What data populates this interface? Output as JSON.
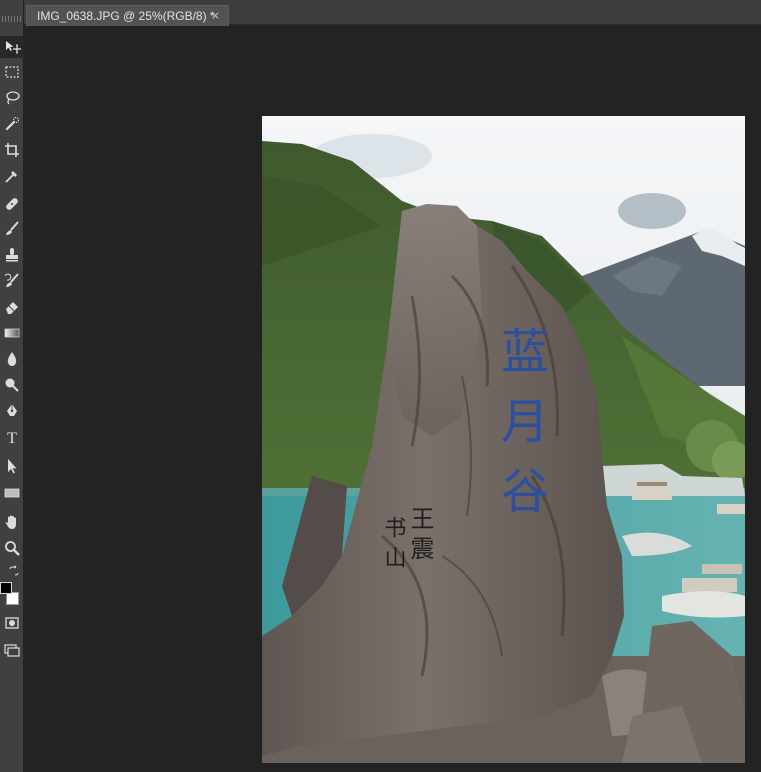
{
  "document_tab": {
    "title": "IMG_0638.JPG @ 25%(RGB/8) *",
    "close_glyph": "×"
  },
  "toolbar": {
    "tools": [
      {
        "name": "move-tool",
        "icon": "move-icon",
        "active": true
      },
      {
        "name": "marquee-tool",
        "icon": "marquee-icon"
      },
      {
        "name": "lasso-tool",
        "icon": "lasso-icon"
      },
      {
        "name": "quick-selection-tool",
        "icon": "quick-selection-icon"
      },
      {
        "name": "crop-tool",
        "icon": "crop-icon"
      },
      {
        "name": "eyedropper-tool",
        "icon": "eyedropper-icon"
      },
      {
        "name": "healing-brush-tool",
        "icon": "bandage-icon"
      },
      {
        "name": "brush-tool",
        "icon": "brush-icon"
      },
      {
        "name": "clone-stamp-tool",
        "icon": "stamp-icon"
      },
      {
        "name": "history-brush-tool",
        "icon": "history-brush-icon"
      },
      {
        "name": "eraser-tool",
        "icon": "eraser-icon"
      },
      {
        "name": "gradient-tool",
        "icon": "gradient-icon"
      },
      {
        "name": "blur-tool",
        "icon": "drop-icon"
      },
      {
        "name": "dodge-tool",
        "icon": "dodge-icon"
      },
      {
        "name": "pen-tool",
        "icon": "pen-icon"
      },
      {
        "name": "type-tool",
        "icon": "type-icon",
        "glyph": "T"
      },
      {
        "name": "path-selection-tool",
        "icon": "arrow-icon"
      },
      {
        "name": "shape-tool",
        "icon": "rectangle-icon"
      },
      {
        "name": "hand-tool",
        "icon": "hand-icon"
      },
      {
        "name": "zoom-tool",
        "icon": "zoom-icon"
      },
      {
        "name": "quick-mask-tool",
        "icon": "quick-mask-icon"
      },
      {
        "name": "screen-mode-tool",
        "icon": "screen-mode-icon"
      }
    ],
    "foreground_color": "#000000",
    "background_color": "#ffffff"
  },
  "photo": {
    "carved_text_blue": "蓝月谷",
    "carved_text_black_right": "王震",
    "carved_text_black_left": "书山"
  }
}
